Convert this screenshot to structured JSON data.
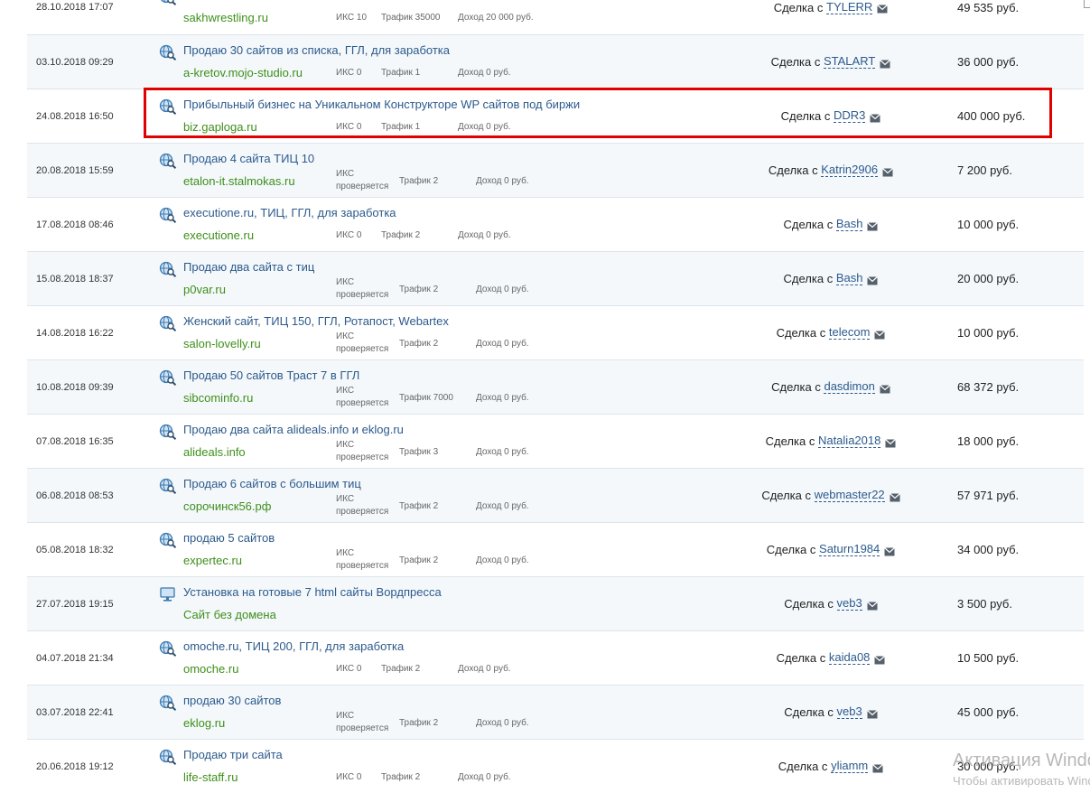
{
  "deal_word": "Сделка с",
  "deals": [
    {
      "date": "28.10.2018 17:07",
      "title": "",
      "domain": "sakhwrestling.ru",
      "icon": "globe-magnifier-icon",
      "iks": "ИКС 10",
      "iks_pending": false,
      "traffic": "Трафик 35000",
      "income": "Доход 20 000 руб.",
      "user": "TYLERR",
      "price": "49 535 руб."
    },
    {
      "date": "03.10.2018 09:29",
      "title": "Продаю 30 сайтов из списка, ГГЛ, для заработка",
      "domain": "a-kretov.mojo-studio.ru",
      "icon": "globe-magnifier-icon",
      "iks": "ИКС 0",
      "iks_pending": false,
      "traffic": "Трафик 1",
      "income": "Доход 0 руб.",
      "user": "STALART",
      "price": "36 000 руб."
    },
    {
      "date": "24.08.2018 16:50",
      "title": "Прибыльный бизнес на Уникальном Конструкторе WP сайтов под биржи",
      "domain": "biz.gaploga.ru",
      "icon": "globe-magnifier-icon",
      "iks": "ИКС 0",
      "iks_pending": false,
      "traffic": "Трафик 1",
      "income": "Доход 0 руб.",
      "user": "DDR3",
      "price": "400 000 руб."
    },
    {
      "date": "20.08.2018 15:59",
      "title": "Продаю 4 сайта ТИЦ 10",
      "domain": "etalon-it.stalmokas.ru",
      "icon": "globe-magnifier-icon",
      "iks": "ИКС",
      "iks_pending": true,
      "iks_note": "проверяется",
      "traffic": "Трафик 2",
      "income": "Доход 0 руб.",
      "user": "Katrin2906",
      "price": "7 200 руб."
    },
    {
      "date": "17.08.2018 08:46",
      "title": "executione.ru, ТИЦ, ГГЛ, для заработка",
      "domain": "executione.ru",
      "icon": "globe-magnifier-icon",
      "iks": "ИКС 0",
      "iks_pending": false,
      "traffic": "Трафик 2",
      "income": "Доход 0 руб.",
      "user": "Bash",
      "price": "10 000 руб."
    },
    {
      "date": "15.08.2018 18:37",
      "title": "Продаю два сайта с тиц",
      "domain": "p0var.ru",
      "icon": "globe-magnifier-icon",
      "iks": "ИКС",
      "iks_pending": true,
      "iks_note": "проверяется",
      "traffic": "Трафик 2",
      "income": "Доход 0 руб.",
      "user": "Bash",
      "price": "20 000 руб."
    },
    {
      "date": "14.08.2018 16:22",
      "title": "Женский сайт, ТИЦ 150, ГГЛ, Ротапост, Webartex",
      "domain": "salon-lovelly.ru",
      "icon": "globe-magnifier-icon",
      "iks": "ИКС",
      "iks_pending": true,
      "iks_note": "проверяется",
      "traffic": "Трафик 2",
      "income": "Доход 0 руб.",
      "user": "telecom",
      "price": "10 000 руб."
    },
    {
      "date": "10.08.2018 09:39",
      "title": "Продаю 50 сайтов Траст 7 в ГГЛ",
      "domain": "sibcominfo.ru",
      "icon": "globe-magnifier-icon",
      "iks": "ИКС",
      "iks_pending": true,
      "iks_note": "проверяется",
      "traffic": "Трафик 7000",
      "income": "Доход 0 руб.",
      "user": "dasdimon",
      "price": "68 372 руб."
    },
    {
      "date": "07.08.2018 16:35",
      "title": "Продаю два сайта alideals.info и eklog.ru",
      "domain": "alideals.info",
      "icon": "globe-magnifier-icon",
      "iks": "ИКС",
      "iks_pending": true,
      "iks_note": "проверяется",
      "traffic": "Трафик 3",
      "income": "Доход 0 руб.",
      "user": "Natalia2018",
      "price": "18 000 руб."
    },
    {
      "date": "06.08.2018 08:53",
      "title": "Продаю 6 сайтов с большим тиц",
      "domain": "сорочинск56.рф",
      "icon": "globe-magnifier-icon",
      "iks": "ИКС",
      "iks_pending": true,
      "iks_note": "проверяется",
      "traffic": "Трафик 2",
      "income": "Доход 0 руб.",
      "user": "webmaster22",
      "price": "57 971 руб."
    },
    {
      "date": "05.08.2018 18:32",
      "title": "продаю 5 сайтов",
      "domain": "expertec.ru",
      "icon": "globe-magnifier-icon",
      "iks": "ИКС",
      "iks_pending": true,
      "iks_note": "проверяется",
      "traffic": "Трафик 2",
      "income": "Доход 0 руб.",
      "user": "Saturn1984",
      "price": "34 000 руб."
    },
    {
      "date": "27.07.2018 19:15",
      "title": "Установка на готовые 7 html сайты Вордпресса",
      "domain": "Сайт без домена",
      "icon": "monitor-icon",
      "iks": "",
      "iks_pending": false,
      "traffic": "",
      "income": "",
      "user": "veb3",
      "price": "3 500 руб."
    },
    {
      "date": "04.07.2018 21:34",
      "title": "omoche.ru, ТИЦ 200, ГГЛ, для заработка",
      "domain": "omoche.ru",
      "icon": "globe-magnifier-icon",
      "iks": "ИКС 0",
      "iks_pending": false,
      "traffic": "Трафик 2",
      "income": "Доход 0 руб.",
      "user": "kaida08",
      "price": "10 500 руб."
    },
    {
      "date": "03.07.2018 22:41",
      "title": "продаю 30 сайтов",
      "domain": "eklog.ru",
      "icon": "globe-magnifier-icon",
      "iks": "ИКС",
      "iks_pending": true,
      "iks_note": "проверяется",
      "traffic": "Трафик 2",
      "income": "Доход 0 руб.",
      "user": "veb3",
      "price": "45 000 руб."
    },
    {
      "date": "20.06.2018 19:12",
      "title": "Продаю три сайта",
      "domain": "life-staff.ru",
      "icon": "globe-magnifier-icon",
      "iks": "ИКС 0",
      "iks_pending": false,
      "traffic": "Трафик 2",
      "income": "Доход 0 руб.",
      "user": "yliamm",
      "price": "30 000 руб."
    }
  ],
  "watermark": {
    "line1": "Активация Windo",
    "line2": "Чтобы активировать Wind"
  },
  "colors": {
    "highlight": "#e00000",
    "title_link": "#2c5a8c",
    "domain_link": "#3e8f1a"
  }
}
